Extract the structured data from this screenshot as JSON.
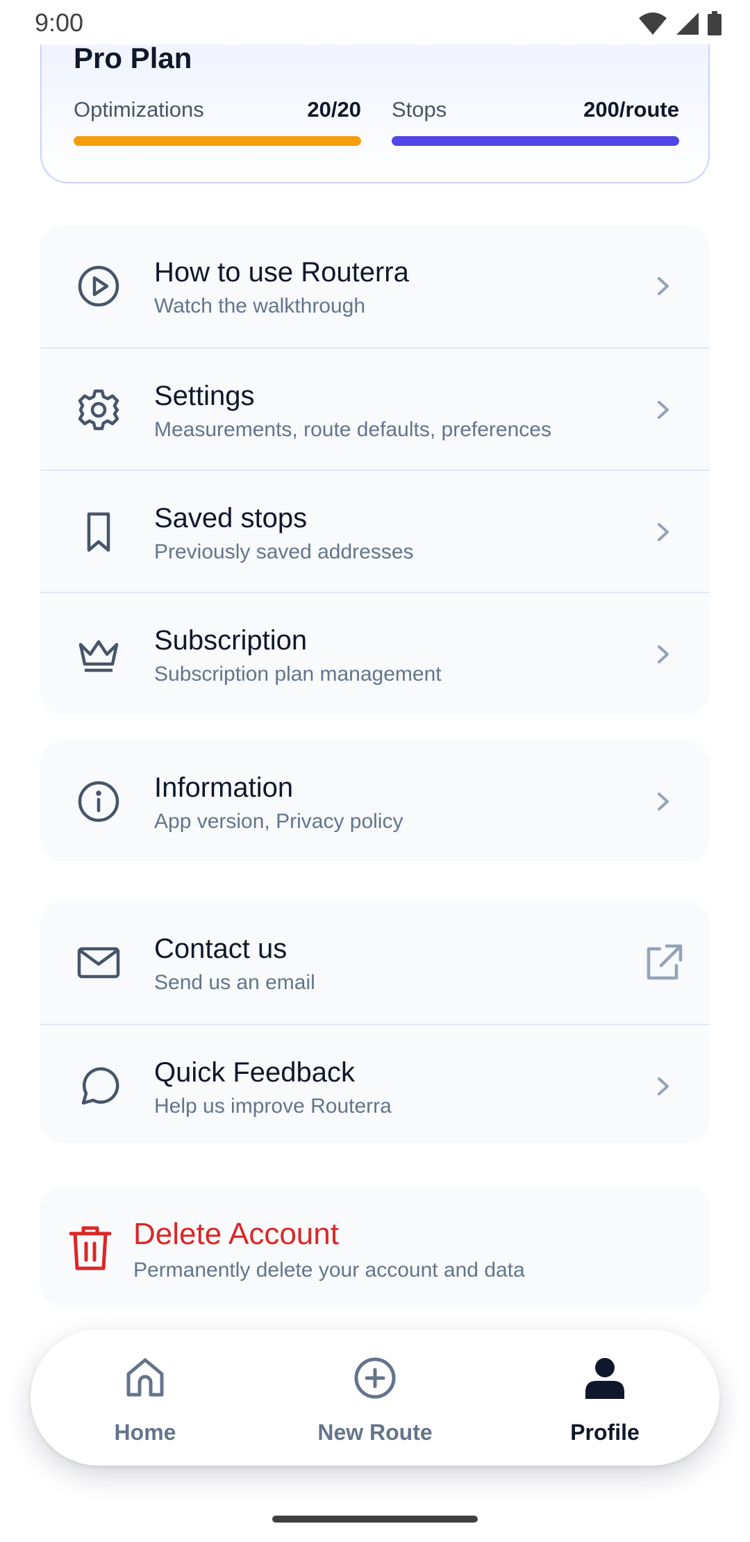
{
  "status_bar": {
    "time": "9:00"
  },
  "plan": {
    "title": "Pro Plan",
    "optimizations": {
      "label": "Optimizations",
      "value": "20/20",
      "fill": 1.0,
      "color": "#f59e0b"
    },
    "stops": {
      "label": "Stops",
      "value": "200/route",
      "fill": 1.0,
      "color": "#4f46e5"
    }
  },
  "menu": {
    "how_to": {
      "title": "How to use Routerra",
      "subtitle": "Watch the walkthrough",
      "icon": "play-circle-icon"
    },
    "settings": {
      "title": "Settings",
      "subtitle": "Measurements, route defaults, preferences",
      "icon": "gear-icon"
    },
    "saved_stops": {
      "title": "Saved stops",
      "subtitle": "Previously saved addresses",
      "icon": "bookmark-icon"
    },
    "subscription": {
      "title": "Subscription",
      "subtitle": "Subscription plan management",
      "icon": "crown-icon"
    },
    "information": {
      "title": "Information",
      "subtitle": "App version, Privacy policy",
      "icon": "info-icon"
    },
    "contact": {
      "title": "Contact us",
      "subtitle": "Send us an email",
      "icon": "mail-icon"
    },
    "feedback": {
      "title": "Quick Feedback",
      "subtitle": "Help us improve Routerra",
      "icon": "chat-icon"
    }
  },
  "delete_account": {
    "title": "Delete Account",
    "subtitle": "Permanently delete your account and data",
    "color": "#dc2626"
  },
  "nav": {
    "home": {
      "label": "Home",
      "icon": "home-icon"
    },
    "new_route": {
      "label": "New Route",
      "icon": "plus-circle-icon"
    },
    "profile": {
      "label": "Profile",
      "icon": "person-icon",
      "active": true
    }
  },
  "colors": {
    "accent": "#4f46e5",
    "warning": "#f59e0b",
    "danger": "#dc2626",
    "icon": "#475569"
  }
}
